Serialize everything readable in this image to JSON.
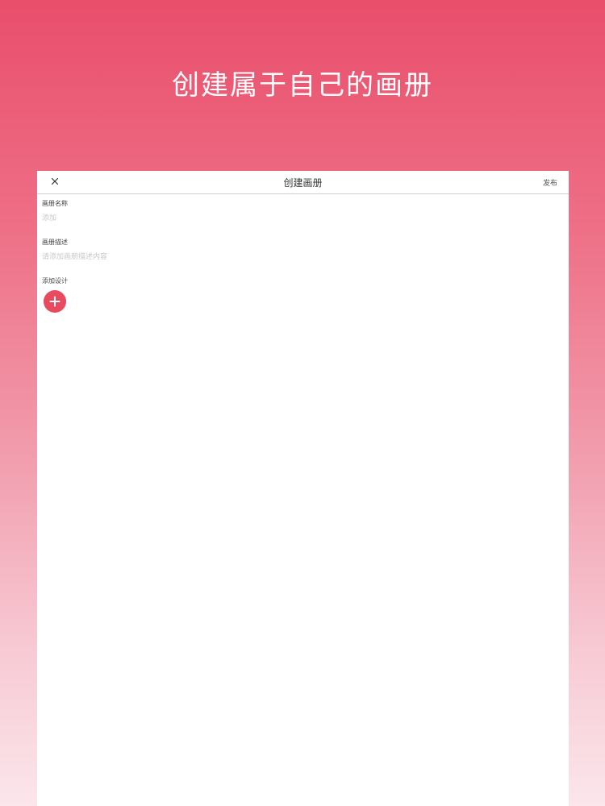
{
  "promo": {
    "headline": "创建属于自己的画册"
  },
  "nav": {
    "title": "创建画册",
    "publish_label": "发布"
  },
  "form": {
    "name_label": "画册名称",
    "name_placeholder": "添加",
    "desc_label": "画册描述",
    "desc_placeholder": "请添加画册描述内容",
    "design_label": "添加设计"
  },
  "colors": {
    "accent": "#e84a5f",
    "gradient_top": "#e94e6b",
    "gradient_bottom": "#fbe6eb"
  },
  "icons": {
    "close": "close-icon",
    "add": "plus-icon"
  }
}
